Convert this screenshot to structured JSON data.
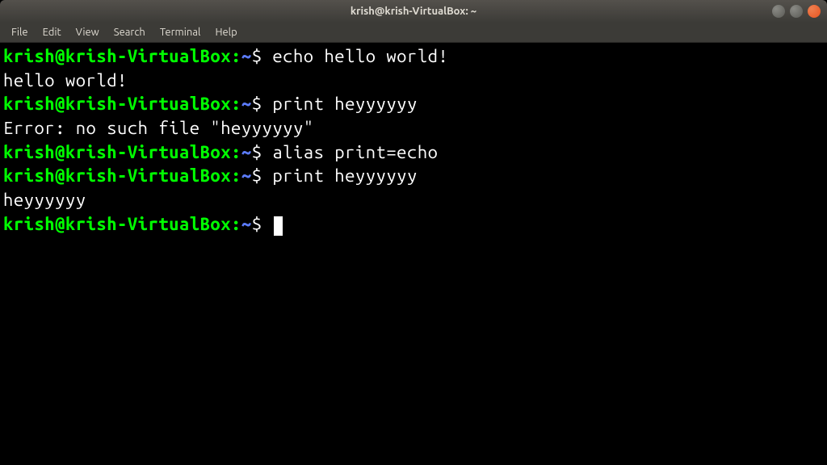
{
  "window": {
    "title": "krish@krish-VirtualBox: ~"
  },
  "menubar": {
    "items": [
      "File",
      "Edit",
      "View",
      "Search",
      "Terminal",
      "Help"
    ]
  },
  "prompt": {
    "user_host": "krish@krish-VirtualBox",
    "path": "~",
    "symbol": "$"
  },
  "session": {
    "lines": [
      {
        "type": "cmd",
        "command": "echo hello world!"
      },
      {
        "type": "out",
        "text": "hello world!"
      },
      {
        "type": "cmd",
        "command": "print heyyyyyy"
      },
      {
        "type": "out",
        "text": "Error: no such file \"heyyyyyy\""
      },
      {
        "type": "cmd",
        "command": "alias print=echo"
      },
      {
        "type": "cmd",
        "command": "print heyyyyyy"
      },
      {
        "type": "out",
        "text": "heyyyyyy"
      },
      {
        "type": "cmd",
        "command": "",
        "cursor": true
      }
    ]
  }
}
